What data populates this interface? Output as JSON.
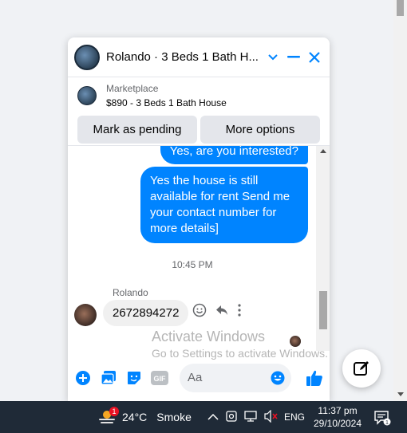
{
  "chat": {
    "title": "Rolando · 3 Beds 1 Bath H...",
    "listing": {
      "source": "Marketplace",
      "title": "$890 - 3 Beds 1 Bath House"
    },
    "actions": {
      "mark_pending": "Mark as pending",
      "more_options": "More options"
    },
    "messages": {
      "out_1": "Yes, are you interested?",
      "out_2": "Yes the house is still available for rent Send me your contact number for more details]",
      "timestamp": "10:45 PM",
      "sender_name": "Rolando",
      "in_1": "2672894272"
    },
    "composer": {
      "placeholder": "Aa"
    }
  },
  "watermark": {
    "line1": "Activate Windows",
    "line2": "Go to Settings to activate Windows."
  },
  "taskbar": {
    "weather_badge": "1",
    "temperature": "24°C",
    "condition": "Smoke",
    "language": "ENG",
    "time": "11:37 pm",
    "date": "29/10/2024",
    "notification_count": "1"
  },
  "colors": {
    "messenger_blue": "#0084ff",
    "taskbar": "#1f2a37"
  }
}
